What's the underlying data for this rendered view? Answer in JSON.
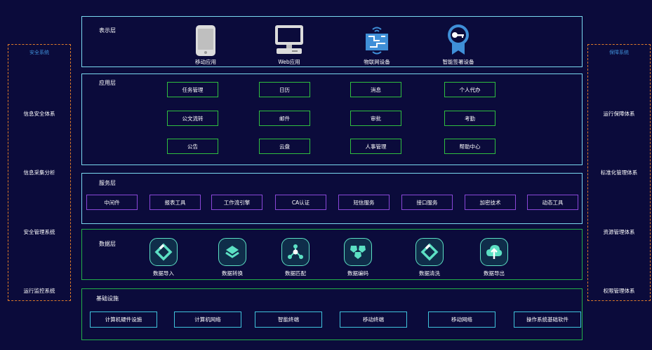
{
  "left_panel": {
    "title": "安全系统",
    "items": [
      "信息安全体系",
      "信息采集分析",
      "安全管理系统",
      "运行监控系统"
    ]
  },
  "right_panel": {
    "title": "保障系统",
    "items": [
      "运行保障体系",
      "标准化管理体系",
      "资源管理体系",
      "权限管理体系"
    ]
  },
  "presentation": {
    "title": "表示层",
    "items": [
      "移动应用",
      "Web应用",
      "物联网设备",
      "智能签署设备"
    ]
  },
  "application": {
    "title": "应用层",
    "rows": [
      [
        "任务管理",
        "日历",
        "消息",
        "个人代办"
      ],
      [
        "公文流转",
        "邮件",
        "审批",
        "考勤"
      ],
      [
        "公告",
        "云盘",
        "人事管理",
        "帮助中心"
      ]
    ]
  },
  "service": {
    "title": "服务层",
    "items": [
      "中间件",
      "报表工具",
      "工作流引擎",
      "CA认证",
      "短信服务",
      "接口服务",
      "加密技术",
      "动态工具"
    ]
  },
  "data_layer": {
    "title": "数据层",
    "items": [
      "数据导入",
      "数据转换",
      "数据匹配",
      "数据编码",
      "数据清洗",
      "数据导出"
    ]
  },
  "infrastructure": {
    "title": "基础设施",
    "items": [
      "计算机硬件设施",
      "计算机网络",
      "智能终端",
      "移动终端",
      "移动网络",
      "操作系统基础软件"
    ]
  },
  "colors": {
    "background": "#0b0b3b",
    "cyan_border": "#7ad9f0",
    "green_border": "#2fbf3f",
    "purple_border": "#8a47d8",
    "orange_dash": "#e07b2a",
    "teal_icon": "#5ce0c4"
  }
}
